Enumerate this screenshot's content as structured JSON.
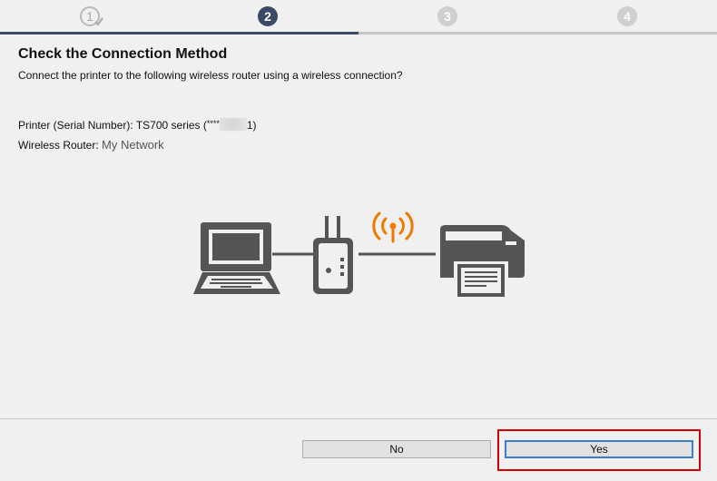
{
  "steps": [
    {
      "label": "1",
      "state": "completed"
    },
    {
      "label": "2",
      "state": "active"
    },
    {
      "label": "3",
      "state": "pending"
    },
    {
      "label": "4",
      "state": "pending"
    }
  ],
  "heading": {
    "title": "Check the Connection Method",
    "subtitle": "Connect the printer to the following wireless router using a wireless connection?"
  },
  "info": {
    "printer_label": "Printer (Serial Number): ",
    "printer_model": "TS700 series (",
    "serial_prefix": "****",
    "serial_suffix": "1)",
    "router_label": "Wireless Router: ",
    "router_value": "My Network"
  },
  "buttons": {
    "no_label": "No",
    "yes_label": "Yes"
  },
  "colors": {
    "accent": "#3a4a66",
    "wifi_signal": "#f07a00",
    "highlight": "#d50000",
    "device_gray": "#555555"
  },
  "icons": [
    "laptop-icon",
    "router-icon",
    "wifi-signal-icon",
    "printer-icon",
    "check-icon"
  ]
}
